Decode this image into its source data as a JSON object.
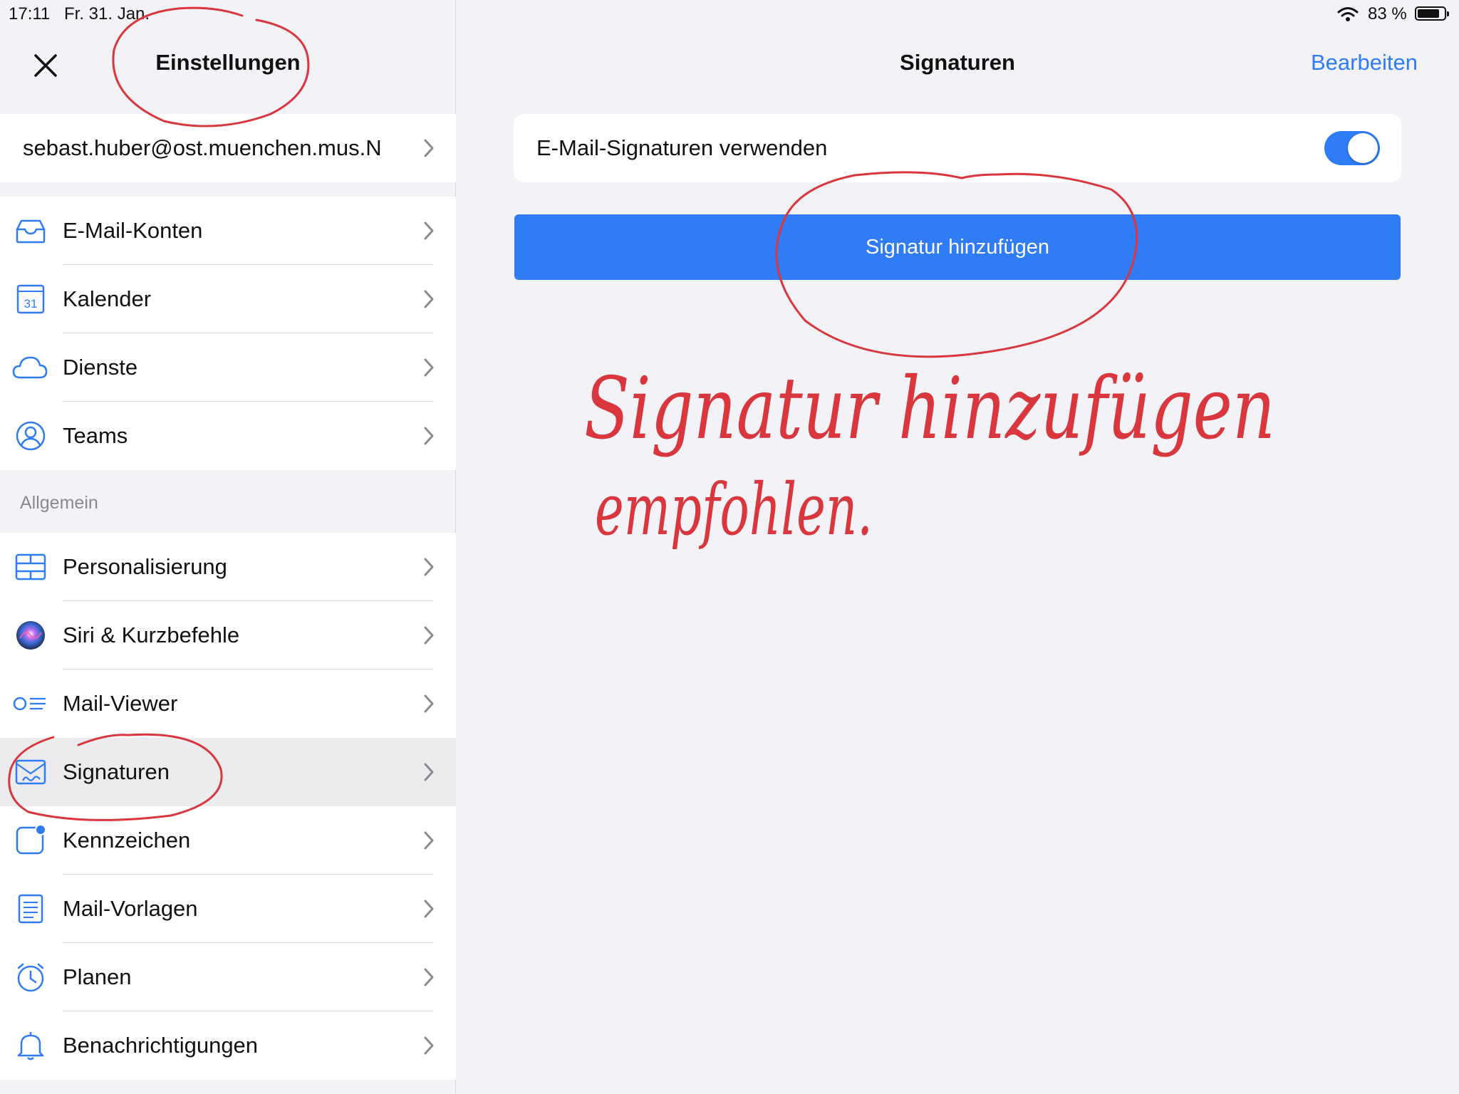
{
  "status_bar": {
    "time": "17:11",
    "date": "Fr. 31. Jan.",
    "battery_percent": "83 %",
    "battery_level": 0.83
  },
  "left_panel": {
    "title": "Einstellungen",
    "account": "sebast.huber@ost.muenchen.mus.N",
    "accounts_group": [
      {
        "label": "E-Mail-Konten",
        "icon": "inbox-icon"
      },
      {
        "label": "Kalender",
        "icon": "calendar-icon",
        "icon_text": "31"
      },
      {
        "label": "Dienste",
        "icon": "cloud-icon"
      },
      {
        "label": "Teams",
        "icon": "person-circle-icon"
      }
    ],
    "section_general": "Allgemein",
    "general_group": [
      {
        "label": "Personalisierung",
        "icon": "layout-icon"
      },
      {
        "label": "Siri & Kurzbefehle",
        "icon": "siri-icon"
      },
      {
        "label": "Mail-Viewer",
        "icon": "list-icon"
      },
      {
        "label": "Signaturen",
        "icon": "signature-icon",
        "selected": true
      },
      {
        "label": "Kennzeichen",
        "icon": "badge-icon"
      },
      {
        "label": "Mail-Vorlagen",
        "icon": "document-icon"
      },
      {
        "label": "Planen",
        "icon": "alarm-icon"
      },
      {
        "label": "Benachrichtigungen",
        "icon": "bell-icon"
      }
    ]
  },
  "right_panel": {
    "title": "Signaturen",
    "edit_label": "Bearbeiten",
    "toggle_label": "E-Mail-Signaturen verwenden",
    "toggle_on": true,
    "add_button": "Signatur hinzufügen"
  },
  "annotation": {
    "handwritten_line1": "Signatur hinzufügen",
    "handwritten_line2": "empfohlen.",
    "color": "#d9363e"
  },
  "colors": {
    "accent": "#2f7cf6",
    "background": "#f2f2f7",
    "annotation": "#d9363e"
  }
}
